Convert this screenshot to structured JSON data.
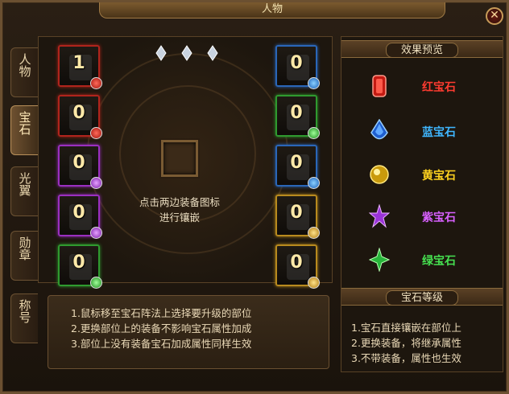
{
  "window": {
    "title": "人物",
    "close_label": "✕"
  },
  "tabs": [
    {
      "label": "人物",
      "active": false
    },
    {
      "label": "宝石",
      "active": true
    },
    {
      "label": "光翼",
      "active": false
    },
    {
      "label": "勋章",
      "active": false
    },
    {
      "label": "称号",
      "active": false
    }
  ],
  "left_slots": [
    {
      "count": "1",
      "gem": "red"
    },
    {
      "count": "0",
      "gem": "red"
    },
    {
      "count": "0",
      "gem": "purple"
    },
    {
      "count": "0",
      "gem": "purple"
    },
    {
      "count": "0",
      "gem": "green"
    }
  ],
  "right_slots": [
    {
      "count": "0",
      "gem": "blue"
    },
    {
      "count": "0",
      "gem": "green"
    },
    {
      "count": "0",
      "gem": "blue"
    },
    {
      "count": "0",
      "gem": "gold"
    },
    {
      "count": "0",
      "gem": "gold"
    }
  ],
  "center": {
    "hint_line1": "点击两边装备图标",
    "hint_line2": "进行镶嵌"
  },
  "tips": [
    "1.鼠标移至宝石阵法上选择要升级的部位",
    "2.更换部位上的装备不影响宝石属性加成",
    "3.部位上没有装备宝石加成属性同样生效"
  ],
  "effect_preview": {
    "title": "效果预览",
    "gems": [
      {
        "name": "红宝石",
        "color": "#ff3b30"
      },
      {
        "name": "蓝宝石",
        "color": "#3fb6ff"
      },
      {
        "name": "黄宝石",
        "color": "#ffd21f"
      },
      {
        "name": "紫宝石",
        "color": "#d860ff"
      },
      {
        "name": "绿宝石",
        "color": "#46e050"
      }
    ]
  },
  "gem_level": {
    "title": "宝石等级",
    "lines": [
      "1.宝石直接镶嵌在部位上",
      "2.更换装备，将继承属性",
      "3.不带装备，属性也生效"
    ]
  },
  "colors": {
    "frame": "#6b5031",
    "text": "#ead9b7",
    "title_text": "#f3e2b0"
  }
}
